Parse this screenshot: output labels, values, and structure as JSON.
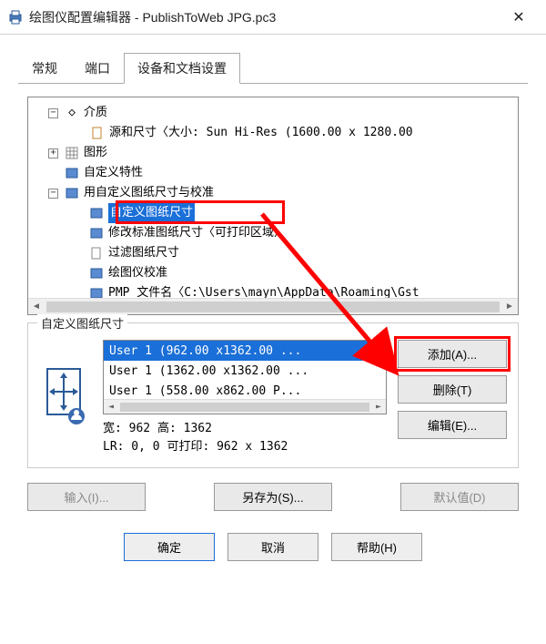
{
  "window": {
    "title": "绘图仪配置编辑器 - PublishToWeb JPG.pc3"
  },
  "tabs": {
    "items": [
      {
        "label": "常规"
      },
      {
        "label": "端口"
      },
      {
        "label": "设备和文档设置"
      }
    ],
    "active_index": 2
  },
  "tree": {
    "items": [
      {
        "depth": 1,
        "expander": "-",
        "icon": "diamond",
        "label": "介质"
      },
      {
        "depth": 2,
        "expander": "",
        "icon": "page",
        "label": "源和尺寸〈大小: Sun Hi-Res (1600.00 x 1280.00"
      },
      {
        "depth": 1,
        "expander": "+",
        "icon": "grid",
        "label": "图形"
      },
      {
        "depth": 1,
        "expander": "",
        "icon": "blue",
        "label": "自定义特性"
      },
      {
        "depth": 1,
        "expander": "-",
        "icon": "blue",
        "label": "用自定义图纸尺寸与校准"
      },
      {
        "depth": 2,
        "expander": "",
        "icon": "blue",
        "label": "自定义图纸尺寸",
        "selected": true
      },
      {
        "depth": 2,
        "expander": "",
        "icon": "blue",
        "label": "修改标准图纸尺寸〈可打印区域〉"
      },
      {
        "depth": 2,
        "expander": "",
        "icon": "page2",
        "label": "过滤图纸尺寸"
      },
      {
        "depth": 2,
        "expander": "",
        "icon": "blue",
        "label": "绘图仪校准"
      },
      {
        "depth": 2,
        "expander": "",
        "icon": "blue",
        "label": "PMP 文件名〈C:\\Users\\mayn\\AppData\\Roaming\\Gst"
      }
    ]
  },
  "group": {
    "title": "自定义图纸尺寸",
    "list": [
      "User 1 (962.00 x1362.00 ...",
      "User 1 (1362.00 x1362.00 ...",
      "User 1 (558.00 x862.00 P..."
    ],
    "selected_index": 0,
    "meta_line1": "宽: 962 高: 1362",
    "meta_line2": "LR: 0, 0 可打印: 962 x 1362",
    "buttons": {
      "add": "添加(A)...",
      "delete": "删除(T)",
      "edit": "编辑(E)..."
    }
  },
  "bottom": {
    "input": "输入(I)...",
    "save_as": "另存为(S)...",
    "default": "默认值(D)"
  },
  "dialog_buttons": {
    "ok": "确定",
    "cancel": "取消",
    "help": "帮助(H)"
  }
}
